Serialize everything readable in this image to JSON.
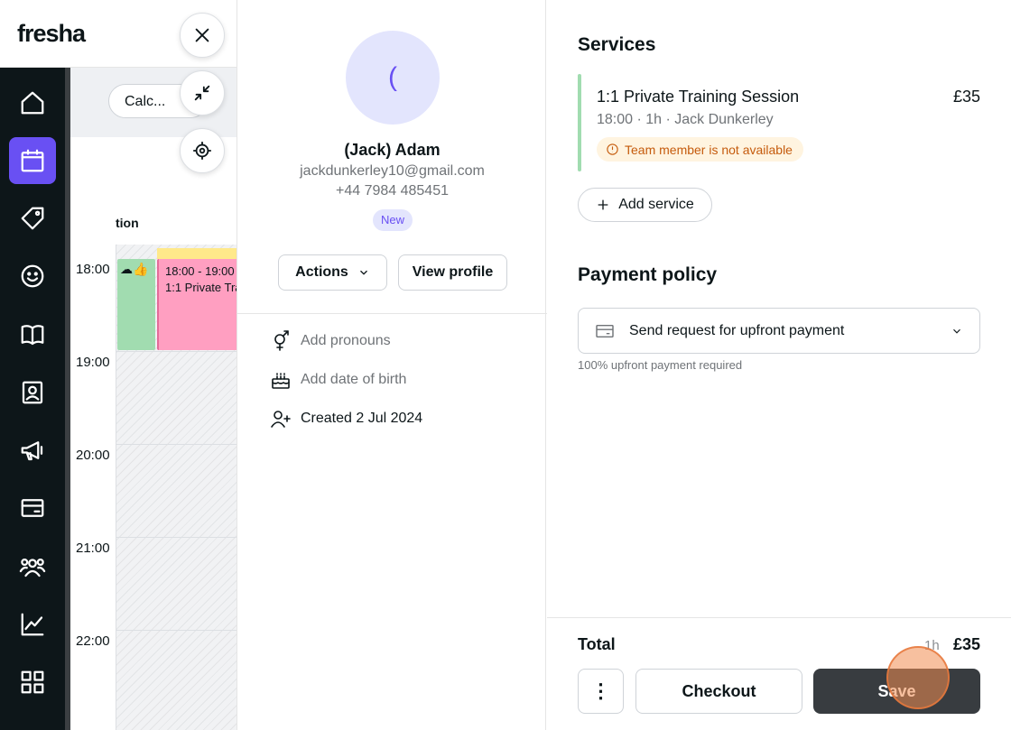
{
  "app": {
    "logo": "fresha"
  },
  "nav": {
    "items": [
      {
        "icon": "home-icon",
        "active": false
      },
      {
        "icon": "calendar-icon",
        "active": true
      },
      {
        "icon": "tag-icon",
        "active": false
      },
      {
        "icon": "smiley-icon",
        "active": false
      },
      {
        "icon": "book-icon",
        "active": false
      },
      {
        "icon": "contact-card-icon",
        "active": false
      },
      {
        "icon": "megaphone-icon",
        "active": false
      },
      {
        "icon": "credit-card-icon",
        "active": false
      },
      {
        "icon": "team-icon",
        "active": false
      },
      {
        "icon": "chart-icon",
        "active": false
      },
      {
        "icon": "grid-icon",
        "active": false
      }
    ],
    "active_color": "#6950f3"
  },
  "calendar": {
    "filter_chip": "Calc...",
    "column_header": "tion",
    "times": [
      "18:00",
      "19:00",
      "20:00",
      "21:00",
      "22:00"
    ],
    "event": {
      "time": "18:00 - 19:00",
      "title": "1:1 Private Tra"
    }
  },
  "client": {
    "initial": "(",
    "name": "(Jack) Adam",
    "email": "jackdunkerley10@gmail.com",
    "phone": "+44 7984 485451",
    "badge": "New",
    "actions_label": "Actions",
    "view_profile_label": "View profile",
    "add_pronouns": "Add pronouns",
    "add_birthday": "Add date of birth",
    "created": "Created 2 Jul 2024"
  },
  "appointment": {
    "services_title": "Services",
    "service": {
      "name": "1:1 Private Training Session",
      "price": "£35",
      "meta": "18:00 · 1h · Jack Dunkerley",
      "warning": "Team member is not available"
    },
    "add_service_label": "Add service",
    "payment_policy_title": "Payment policy",
    "payment_policy_value": "Send request for upfront payment",
    "payment_policy_note": "100% upfront payment required",
    "total_label": "Total",
    "total_duration": "1h",
    "total_price": "£35",
    "more_label": "⋮",
    "checkout_label": "Checkout",
    "save_label": "Save"
  },
  "colors": {
    "accent": "#6950f3",
    "service_green": "#a1dcb0",
    "event_pink": "#ff9fc1",
    "warning_bg": "#fff4e0",
    "warning_text": "#c55b0d",
    "save_bg": "#383c40"
  }
}
